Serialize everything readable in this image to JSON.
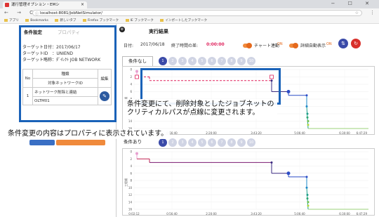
{
  "browser": {
    "tab_title": "運行管理オプション・EMシ",
    "window_controls": "− ☐ ✕",
    "nav_glyphs": "← → C",
    "url": "localhost:8081/JobNetSimulator/",
    "bookmarks": [
      "アプリ",
      "Bookmarks",
      "新しいタブ",
      "Firefox ブックマーク",
      "IE ブックマーク",
      "インポートしたブックマーク"
    ]
  },
  "left_panel": {
    "tabs": [
      "条件設定",
      "プロパティ"
    ],
    "target_date": "ターゲット日付：2017/06/17",
    "target_id": "ターゲットID　：UNIEND",
    "target_name": "ターゲット略称：ﾀﾞｲﾚｸﾄ JOB NETWORK",
    "table": {
      "col_no": "No",
      "col_kind": "種類",
      "col_target": "対象ネットワークID",
      "col_edit": "編集",
      "rows": [
        {
          "no": "1",
          "kind": "ネットワーク削除と連結",
          "target": "OLTM01"
        }
      ]
    }
  },
  "right_panel": {
    "exec_tab": "実行結果",
    "date_label": "日付:",
    "date_value": "2017/06/18",
    "end_label": "終了時間の差:",
    "end_value": "0:00:00",
    "chart_link_label": "チャート連動",
    "chart_link_state": "ON",
    "detail_label": "詳細自動表示",
    "detail_state": "ON",
    "condition_none": "条件なし",
    "condition_with": "条件あり",
    "pager_pages": [
      "1",
      "2",
      "3",
      "4",
      "5",
      "6",
      "7",
      "8",
      "9",
      "10"
    ],
    "yaxis_label": "工程順",
    "x_ticks_top": [
      "",
      "0:56:40",
      "2:20:00",
      "3:43:20",
      "5:06:40",
      "6:30:00"
    ],
    "x_ticks_bottom": [
      "0:02:12",
      "0:56:40",
      "2:20:00",
      "3:43:20",
      "5:06:40",
      "6:30:00"
    ],
    "x_end_label": "6:47:29",
    "y_ticks": [
      "0",
      "2",
      "4",
      "6",
      "8",
      "10",
      "12",
      "14",
      "16"
    ]
  },
  "callouts": {
    "chart_note_line1": "条件変更にて、削除対象としたジョブネットの",
    "chart_note_line2": "クリティカルパスが点線に変更されます。",
    "property_note": "条件変更の内容はプロパティに表示されています。"
  },
  "colors": {
    "highlight": "#1a62b8",
    "accent_orange": "#f08a3c",
    "pager_active": "#3a4aa8",
    "critical_dashed": "#e0245e"
  }
}
